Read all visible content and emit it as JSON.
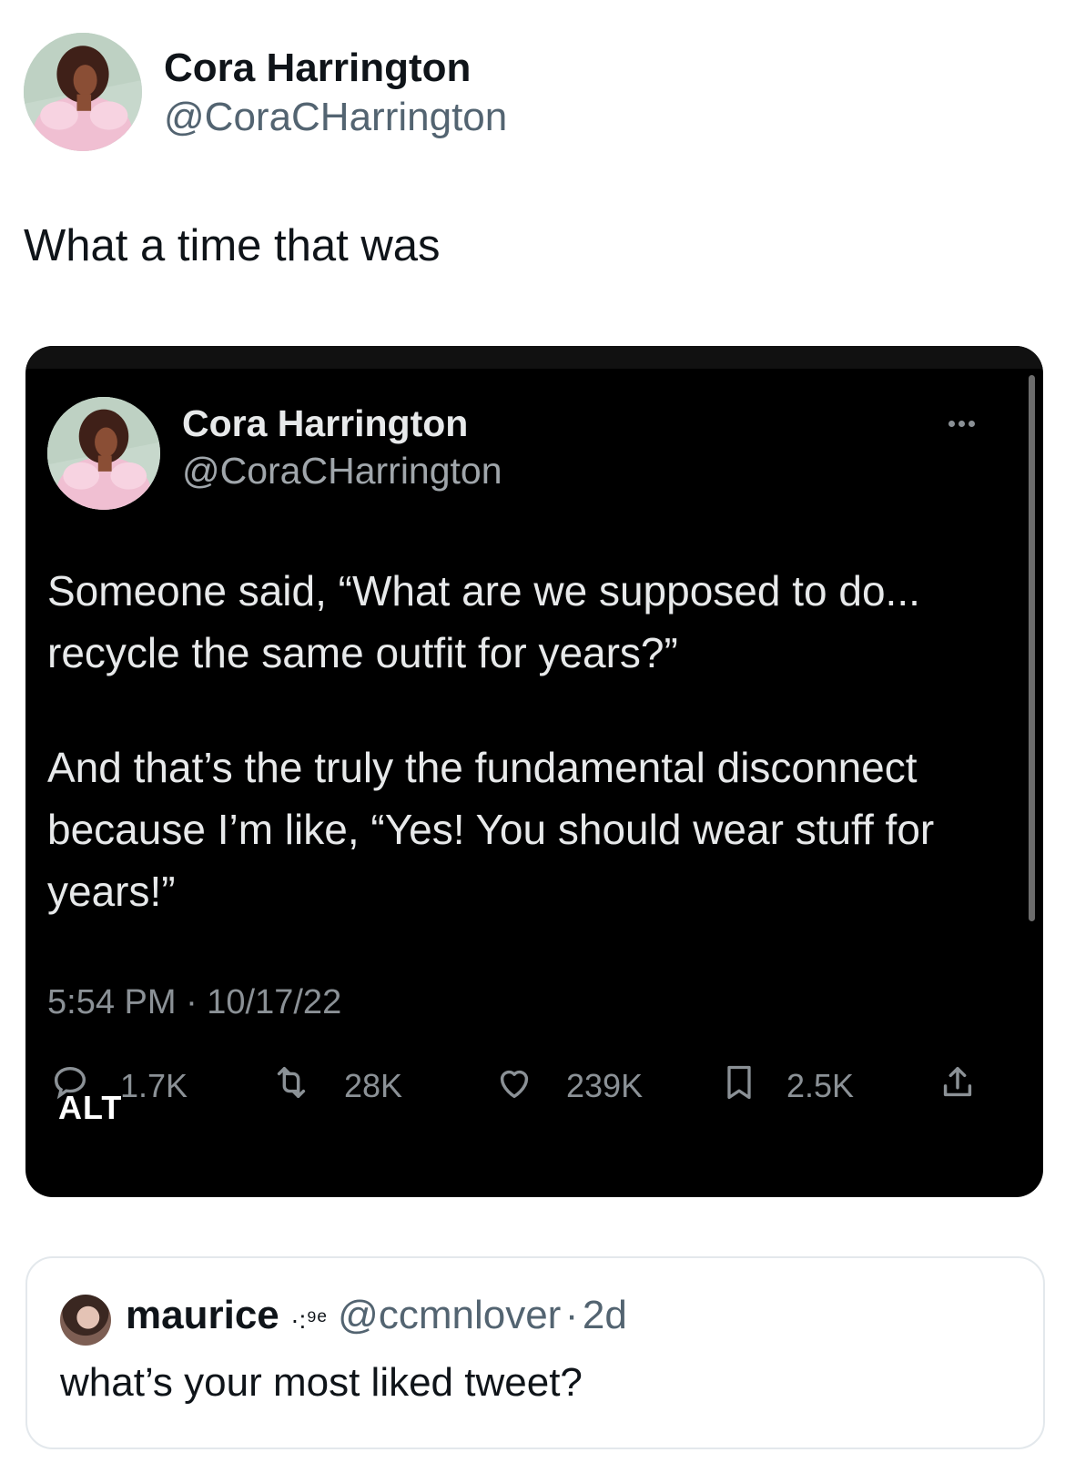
{
  "outer_tweet": {
    "display_name": "Cora Harrington",
    "handle": "@CoraCHarrington",
    "text": "What a time that was"
  },
  "quoted_screenshot": {
    "display_name": "Cora Harrington",
    "handle": "@CoraCHarrington",
    "more_icon": "more-horizontal-icon",
    "paragraph_1_line_1": "Someone said, “What are we supposed to do...",
    "paragraph_1_line_2": "recycle the same outfit for years?”",
    "paragraph_2_line_1": "And that’s the truly the fundamental disconnect",
    "paragraph_2_line_2": "because I’m like, “Yes! You should wear stuff for",
    "paragraph_2_line_3": "years!”",
    "timestamp": "5:54 PM · 10/17/22",
    "actions": {
      "replies": "1.7K",
      "retweets": "28K",
      "likes": "239K",
      "bookmarks": "2.5K"
    },
    "alt_badge": "ALT"
  },
  "reply_card": {
    "display_name": "maurice",
    "emoji": "·:⁹ᵉ",
    "handle": "@ccmnlover",
    "separator": "·",
    "age": "2d",
    "text": "what’s your most liked tweet?"
  },
  "colors": {
    "dark_bg": "#000000",
    "muted_text": "#536471",
    "dark_muted_text": "#8b9196"
  }
}
